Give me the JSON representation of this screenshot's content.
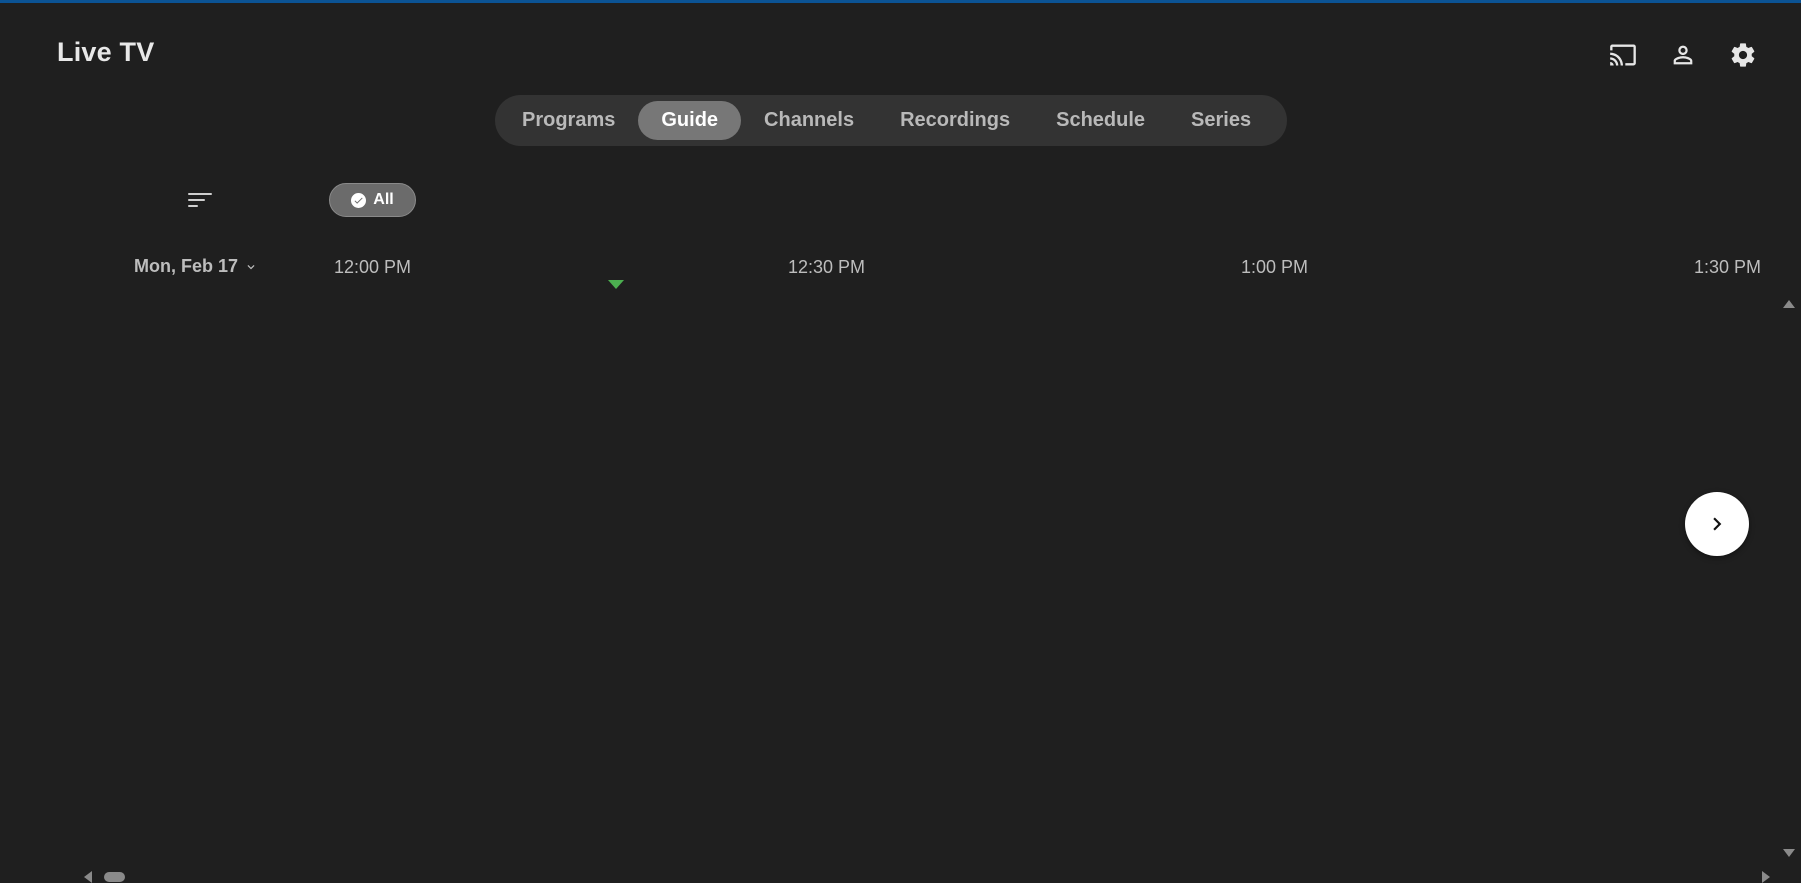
{
  "header": {
    "title": "Live TV",
    "icons": [
      "cast-icon",
      "user-icon",
      "settings-icon"
    ]
  },
  "tabs": [
    {
      "label": "Programs",
      "active": false
    },
    {
      "label": "Guide",
      "active": true
    },
    {
      "label": "Channels",
      "active": false
    },
    {
      "label": "Recordings",
      "active": false
    },
    {
      "label": "Schedule",
      "active": false
    },
    {
      "label": "Series",
      "active": false
    }
  ],
  "filters": {
    "sort_icon": "sort-icon",
    "chip_label": "All",
    "chip_icon": "check-circle-icon"
  },
  "guide": {
    "date": "Mon, Feb 17",
    "times": [
      "12:00 PM",
      "12:30 PM",
      "1:00 PM",
      "1:30 PM"
    ],
    "now_marker_color": "#4caf50"
  },
  "colors": {
    "background": "#1f1f1f",
    "tabbar": "#333333",
    "active_tab": "#777777",
    "accent_top_border": "#0b5394"
  }
}
